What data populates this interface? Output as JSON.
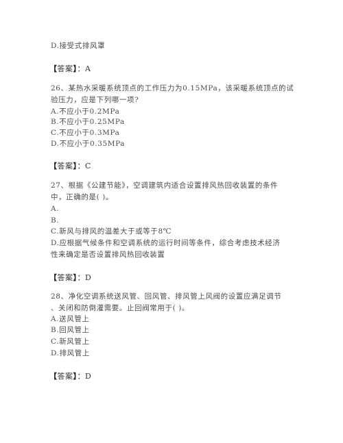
{
  "prev_question_tail": {
    "option_d": "D.接受式排风罩",
    "answer_label": "答案",
    "answer_value": "A"
  },
  "questions": [
    {
      "number": "26",
      "stem_lines": [
        "26、某热水采暖系统顶点的工作压力为0.15MPa，该采暖系统顶点的试",
        "验压力，应是下列哪一项?"
      ],
      "options": [
        "A.不应小于0.2MPa",
        "B.不应小于0.25MPa",
        "C.不应小于0.3MPa",
        "D.不应小于0.35MPa"
      ],
      "answer_label": "答案",
      "answer_value": "C"
    },
    {
      "number": "27",
      "stem_lines": [
        "27、根据《公建节能》，空调建筑内适合设置排风热回收装置的条件",
        "中，正确的是(  )。"
      ],
      "options": [
        "A.",
        "B.",
        "C.新风与排风的温差大于或等于8℃",
        "D.应根据气候条件和空调系统的运行时间等条件，综合考虑技术经济",
        "性来确定是否设置排风热回收装置"
      ],
      "answer_label": "答案",
      "answer_value": "D"
    },
    {
      "number": "28",
      "stem_lines": [
        "28、净化空调系统送风管、回风管、排风管上风阀的设置应满足调节",
        "、关闭和防倒灌需要。止回阀常用于(  )。"
      ],
      "options": [
        "A.送风管上",
        "B.回风管上",
        "C.新风管上",
        "D.排风管上"
      ],
      "answer_label": "答案",
      "answer_value": "D"
    }
  ]
}
